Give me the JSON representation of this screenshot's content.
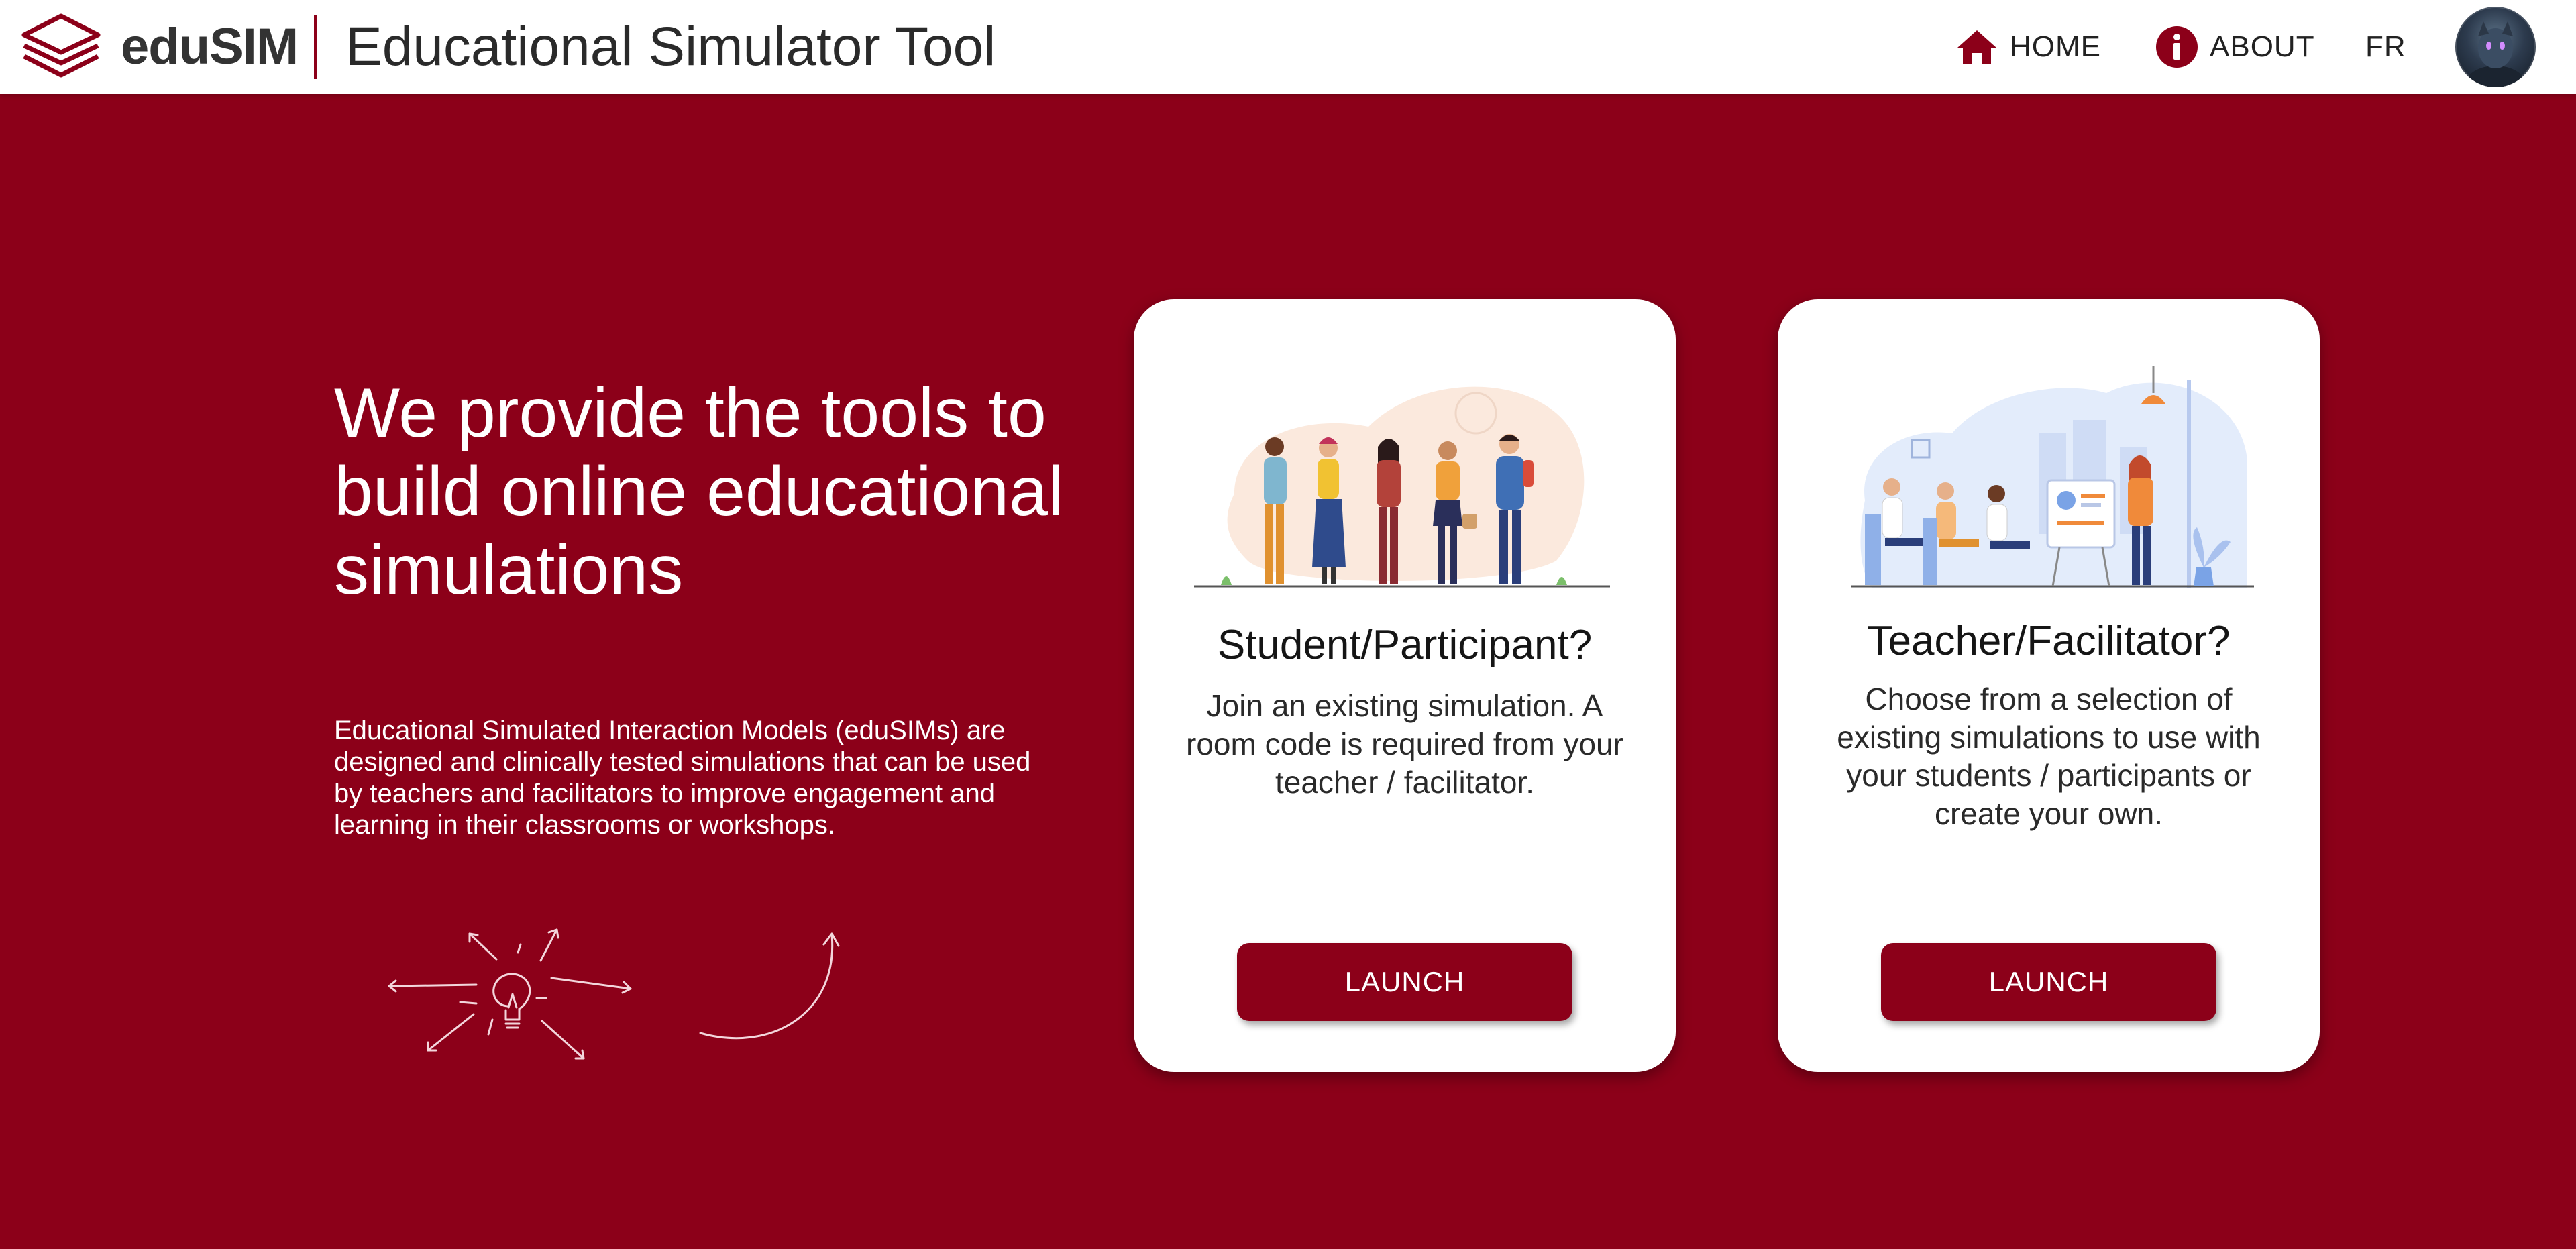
{
  "header": {
    "logo_text": "eduSIM",
    "app_title": "Educational Simulator Tool",
    "nav": {
      "home_label": "HOME",
      "about_label": "ABOUT",
      "language_label": "FR"
    }
  },
  "hero": {
    "title": "We provide the tools to build online educational simulations",
    "description": "Educational Simulated Interaction Models (eduSIMs) are designed and clinically tested simulations that can be used by teachers and facilitators to improve engagement and learning in their classrooms or workshops."
  },
  "cards": [
    {
      "heading": "Student/Participant?",
      "description": "Join an existing simulation. A room code is required from your teacher / facilitator.",
      "button_label": "LAUNCH"
    },
    {
      "heading": "Teacher/Facilitator?",
      "description": "Choose from a selection of existing simulations to use with your students / participants or create your own.",
      "button_label": "LAUNCH"
    }
  ],
  "icons": {
    "logo": "layers-logo-icon",
    "home": "home-icon",
    "about": "info-icon",
    "avatar": "user-avatar"
  },
  "colors": {
    "brand": "#8c0019",
    "header_bg": "#ffffff",
    "card_bg": "#ffffff",
    "text_on_brand": "#ffffff"
  }
}
